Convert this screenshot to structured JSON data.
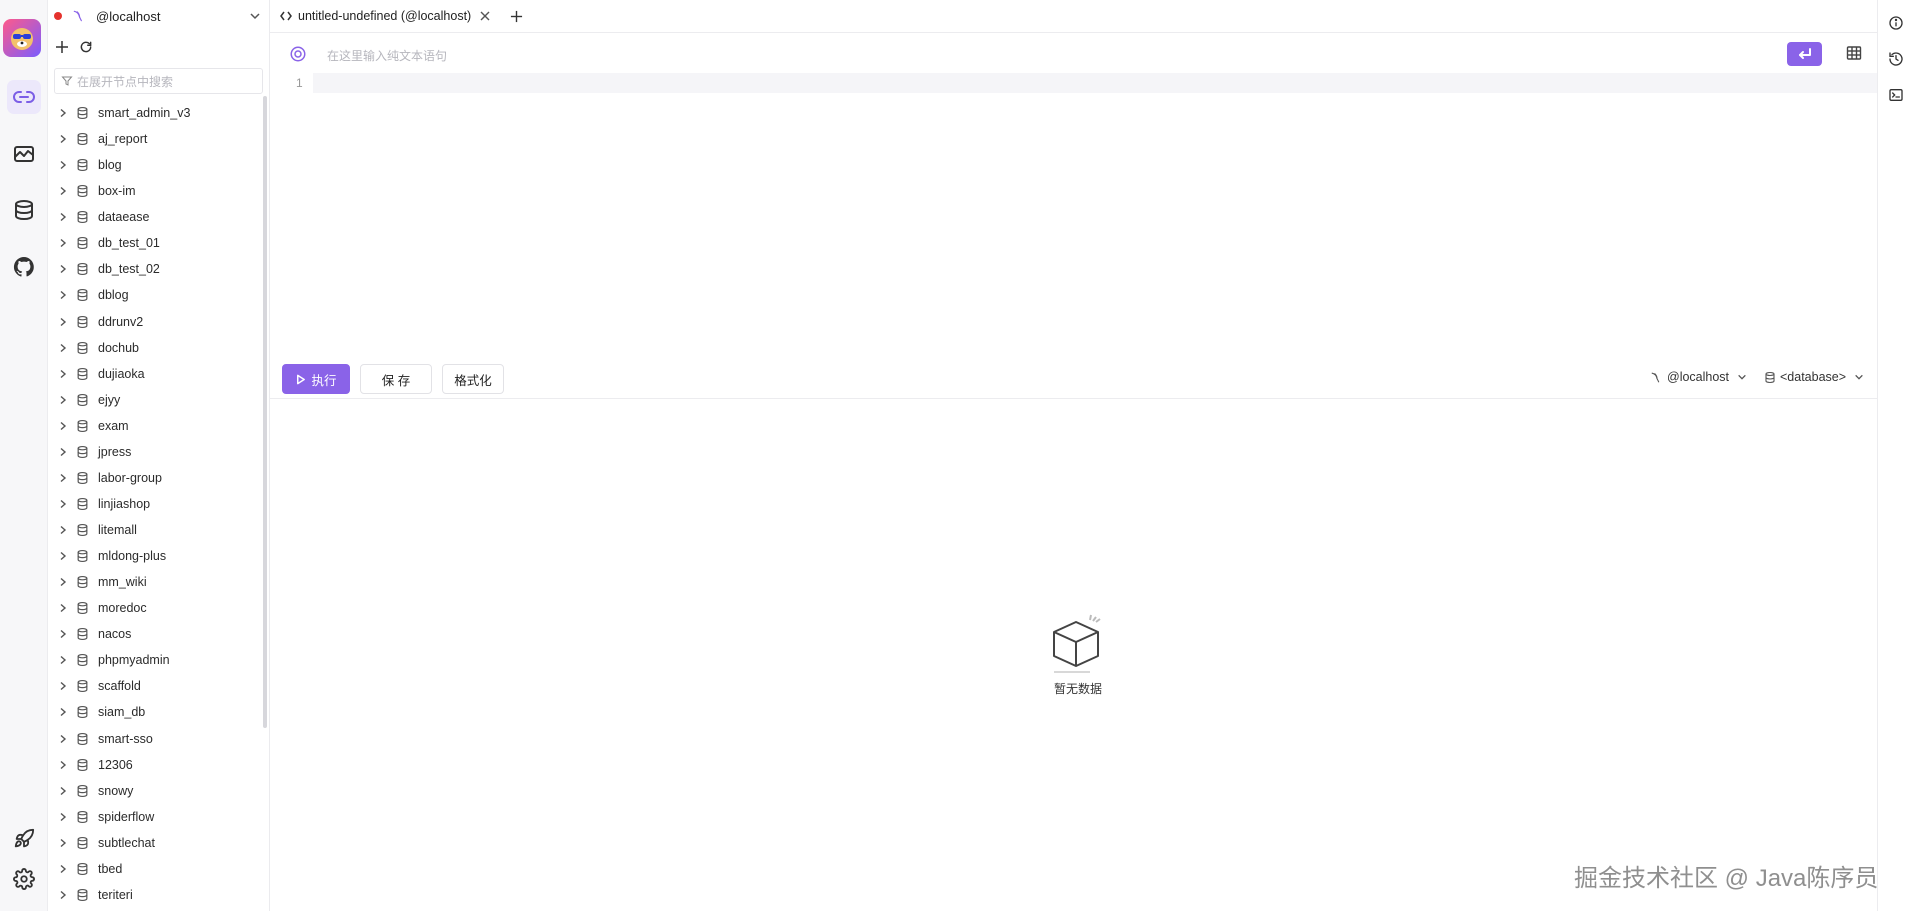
{
  "connection": {
    "name": "@localhost"
  },
  "sidebar": {
    "filter_placeholder": "在展开节点中搜索",
    "databases": [
      "smart_admin_v3",
      "aj_report",
      "blog",
      "box-im",
      "dataease",
      "db_test_01",
      "db_test_02",
      "dblog",
      "ddrunv2",
      "dochub",
      "dujiaoka",
      "ejyy",
      "exam",
      "jpress",
      "labor-group",
      "linjiashop",
      "litemall",
      "mldong-plus",
      "mm_wiki",
      "moredoc",
      "nacos",
      "phpmyadmin",
      "scaffold",
      "siam_db",
      "smart-sso",
      "12306",
      "snowy",
      "spiderflow",
      "subtlechat",
      "tbed",
      "teriteri"
    ]
  },
  "tabs": [
    {
      "label": "untitled-undefined (@localhost)"
    }
  ],
  "editor": {
    "prompt_placeholder": "在这里输入纯文本语句",
    "line_numbers": [
      "1"
    ]
  },
  "toolbar": {
    "execute_label": "执行",
    "save_label": "保 存",
    "format_label": "格式化",
    "connection_select": "@localhost",
    "database_select": "<database>"
  },
  "results": {
    "empty_text": "暂无数据"
  },
  "watermark": "掘金技术社区 @ Java陈序员"
}
